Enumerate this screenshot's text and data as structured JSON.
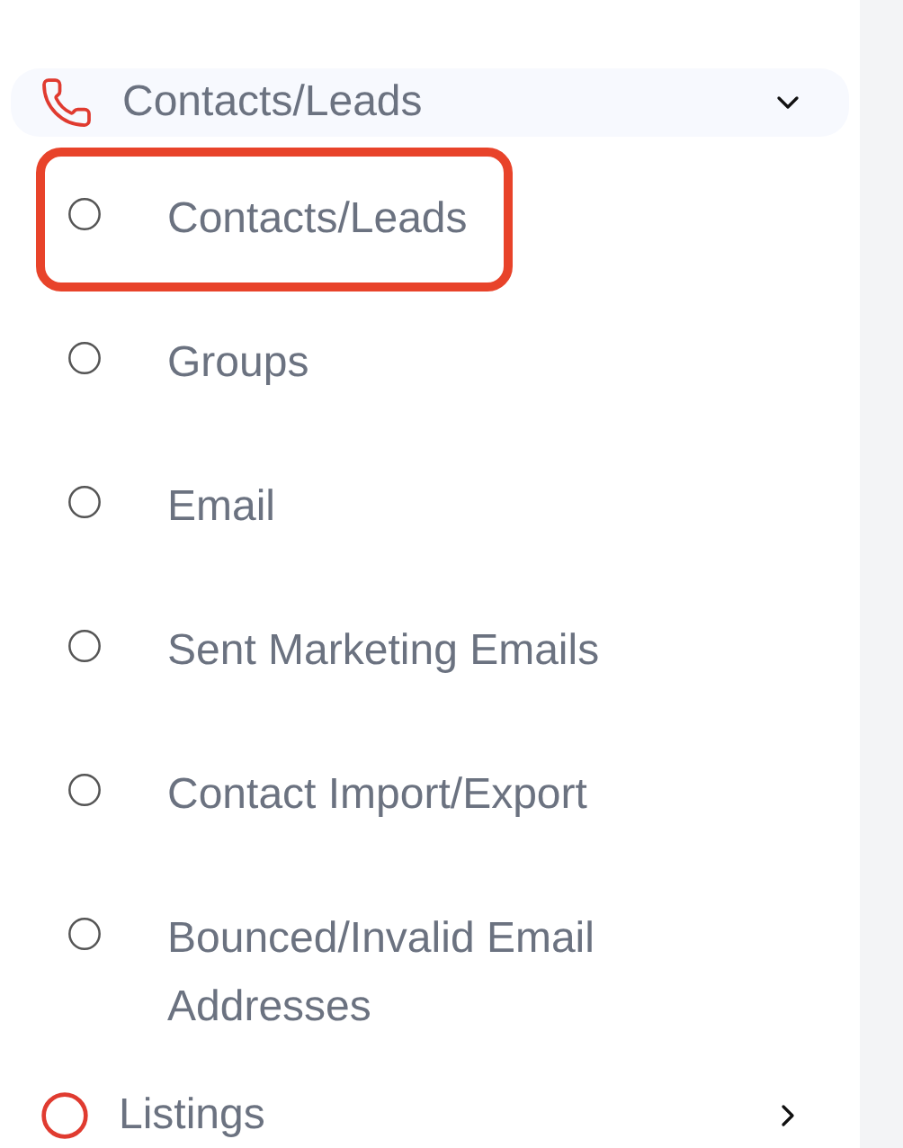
{
  "menu_group": {
    "label": "Contacts/Leads",
    "expanded": true
  },
  "items": [
    {
      "label": "Contacts/Leads",
      "highlighted": true
    },
    {
      "label": "Groups",
      "highlighted": false
    },
    {
      "label": "Email",
      "highlighted": false
    },
    {
      "label": "Sent Marketing Emails",
      "highlighted": false
    },
    {
      "label": "Contact Import/Export",
      "highlighted": false
    },
    {
      "label": "Bounced/Invalid Email Addresses",
      "highlighted": false
    }
  ],
  "next_group": {
    "label": "Listings",
    "expanded": false
  }
}
